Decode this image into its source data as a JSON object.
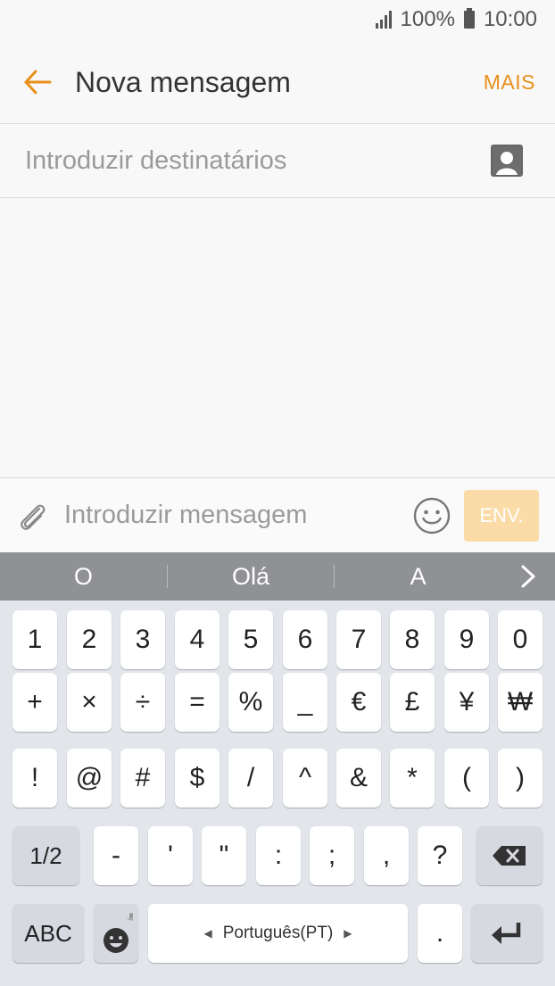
{
  "status_bar": {
    "battery": "100%",
    "time": "10:00"
  },
  "header": {
    "title": "Nova mensagem",
    "more_label": "MAIS"
  },
  "recipients": {
    "placeholder": "Introduzir destinatários"
  },
  "composer": {
    "placeholder": "Introduzir mensagem",
    "send_label": "ENV."
  },
  "suggestions": [
    "O",
    "Olá",
    "A"
  ],
  "keyboard": {
    "row1": [
      "1",
      "2",
      "3",
      "4",
      "5",
      "6",
      "7",
      "8",
      "9",
      "0"
    ],
    "row2": [
      "+",
      "×",
      "÷",
      "=",
      "%",
      "_",
      "€",
      "£",
      "¥",
      "₩"
    ],
    "row3": [
      "!",
      "@",
      "#",
      "$",
      "/",
      "^",
      "&",
      "*",
      "(",
      ")"
    ],
    "row4": [
      "-",
      "'",
      "\"",
      ":",
      ";",
      ",",
      "?"
    ],
    "page_toggle": "1/2",
    "abc_label": "ABC",
    "space_label": "Português(PT)",
    "period": "."
  },
  "colors": {
    "accent": "#e8901a",
    "send_disabled": "#fbdca8",
    "suggestion_bar": "#8f9195",
    "keyboard_bg": "#e2e5ea"
  }
}
